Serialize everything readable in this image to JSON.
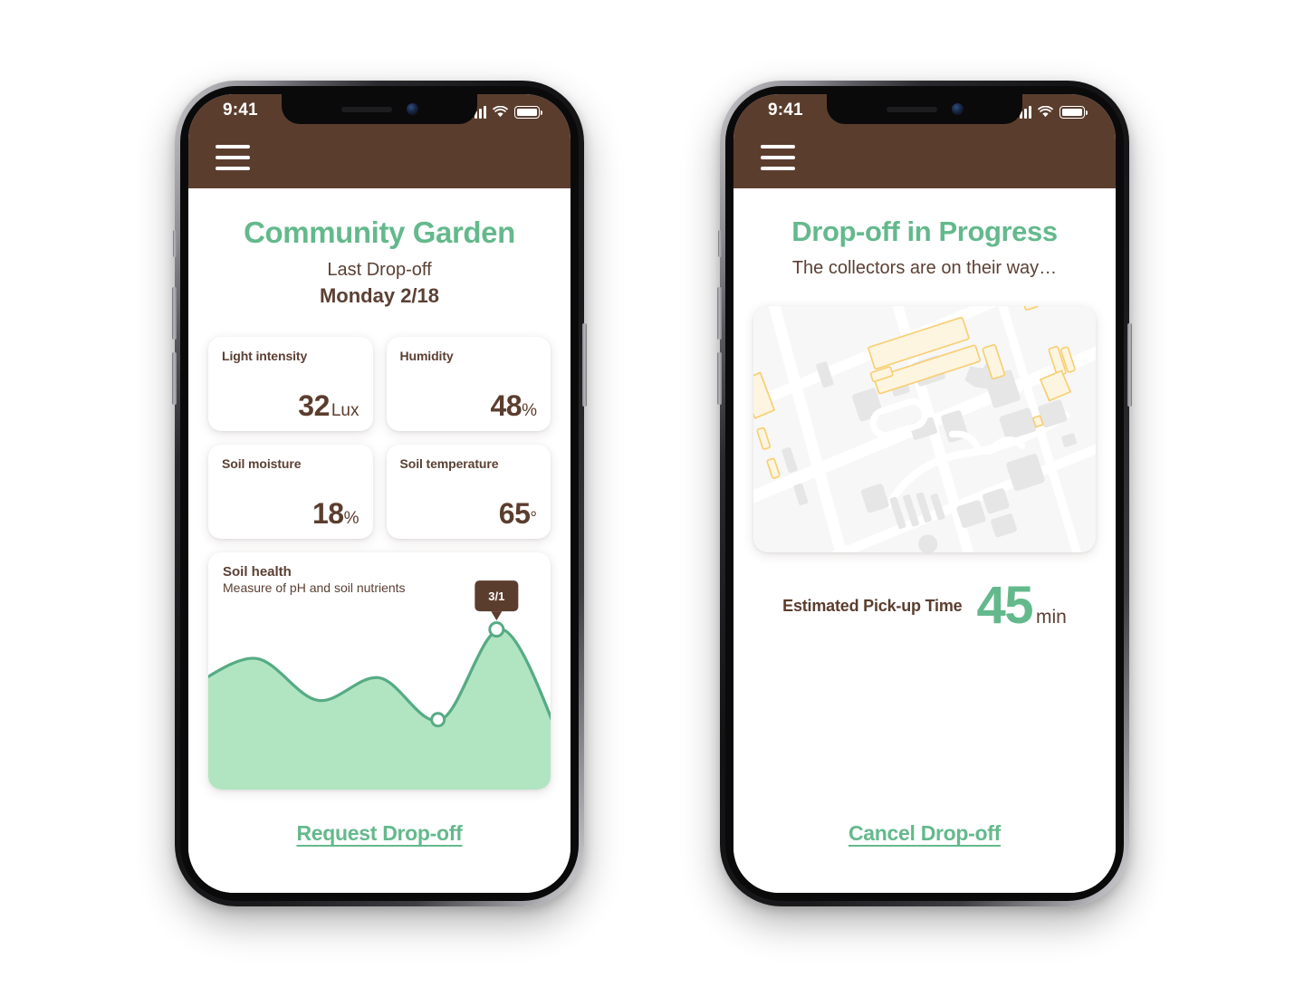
{
  "phones": [
    {
      "status_bar": {
        "time": "9:41",
        "signal": "signal-bars-icon",
        "wifi": "wifi-icon",
        "battery": "battery-icon"
      },
      "nav": {
        "menu": "hamburger-menu-icon"
      },
      "header": {
        "title": "Community Garden",
        "subtitle_label": "Last Drop-off",
        "subtitle_value": "Monday 2/18"
      },
      "stats": [
        {
          "label": "Light intensity",
          "value": "32",
          "unit": "Lux"
        },
        {
          "label": "Humidity",
          "value": "48",
          "unit": "%"
        },
        {
          "label": "Soil moisture",
          "value": "18",
          "unit": "%"
        },
        {
          "label": "Soil temperature",
          "value": "65",
          "unit": "°"
        }
      ],
      "chart_card": {
        "title": "Soil health",
        "subtitle": "Measure of pH and soil nutrients",
        "tooltip": "3/1"
      },
      "cta": {
        "label": "Request Drop-off"
      }
    },
    {
      "status_bar": {
        "time": "9:41",
        "signal": "signal-bars-icon",
        "wifi": "wifi-icon",
        "battery": "battery-icon"
      },
      "nav": {
        "menu": "hamburger-menu-icon"
      },
      "header": {
        "title": "Drop-off in Progress",
        "subtitle_label": "The collectors are on their way…"
      },
      "map": {
        "name": "route-map"
      },
      "eta": {
        "label": "Estimated Pick-up Time",
        "value": "45",
        "unit": "min"
      },
      "cta": {
        "label": "Cancel Drop-off"
      }
    }
  ],
  "colors": {
    "brand_green": "#64b98c",
    "area_green": "#b1e5c2",
    "header_brown": "#5b3d2e",
    "text_brown": "#5b4034",
    "card_white": "#ffffff",
    "map_bg": "#f7f7f7",
    "map_building": "#e4e4e4",
    "map_highlight": "#fbd77a"
  },
  "chart_data": {
    "type": "area",
    "title": "Soil health",
    "subtitle": "Measure of pH and soil nutrients",
    "xlabel": "",
    "ylabel": "",
    "grid": false,
    "legend": false,
    "smoothing": "spline",
    "x": [
      0,
      1,
      2,
      3,
      4,
      5,
      6
    ],
    "values": [
      62,
      78,
      52,
      66,
      40,
      96,
      22
    ],
    "ylim": [
      0,
      100
    ],
    "annotations": [
      {
        "x": 5,
        "y": 96,
        "label": "3/1",
        "marker": true
      },
      {
        "x": 4,
        "y": 40,
        "label": "",
        "marker": true
      }
    ],
    "fill_color": "#b1e5c2",
    "line_color": "#56ab84"
  }
}
